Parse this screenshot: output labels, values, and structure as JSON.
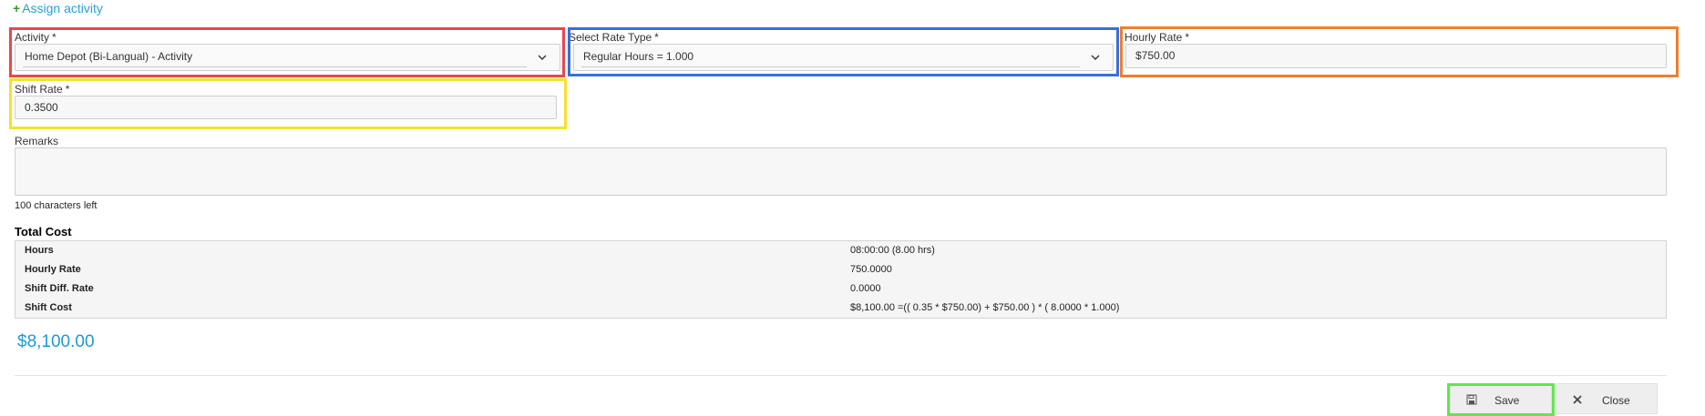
{
  "assign": {
    "label": "Assign activity",
    "plus": "+"
  },
  "activity": {
    "label": "Activity",
    "required": "*",
    "value": "Home Depot (Bi-Langual) - Activity"
  },
  "rate_type": {
    "label": "Select Rate Type",
    "required": "*",
    "value": "Regular Hours = 1.000"
  },
  "hourly_rate": {
    "label": "Hourly Rate",
    "required": "*",
    "value": "$750.00"
  },
  "shift_rate": {
    "label": "Shift Rate",
    "required": "*",
    "value": "0.3500"
  },
  "remarks": {
    "label": "Remarks",
    "value": "",
    "chars_left": "100 characters left"
  },
  "total_cost": {
    "title": "Total Cost",
    "rows": [
      {
        "key": "Hours",
        "value": "08:00:00 (8.00 hrs)"
      },
      {
        "key": "Hourly Rate",
        "value": "750.0000"
      },
      {
        "key": "Shift Diff. Rate",
        "value": "0.0000"
      },
      {
        "key": "Shift Cost",
        "value": "$8,100.00 =(( 0.35 * $750.00) + $750.00 ) * ( 8.0000 * 1.000)"
      }
    ],
    "amount": "$8,100.00"
  },
  "buttons": {
    "save": "Save",
    "close": "Close"
  },
  "colors": {
    "link": "#2a9fd6",
    "amount": "#1e9ad6",
    "highlight_activity": "#e8474f",
    "highlight_rate_type": "#3a6fd8",
    "highlight_hourly_rate": "#f07f2e",
    "highlight_shift_rate": "#f5e12d",
    "highlight_save": "#5ee84a"
  },
  "icons": {
    "assign": "plus-icon",
    "select": "chevron-down-icon",
    "save": "floppy-disk-icon",
    "close": "x-icon"
  }
}
